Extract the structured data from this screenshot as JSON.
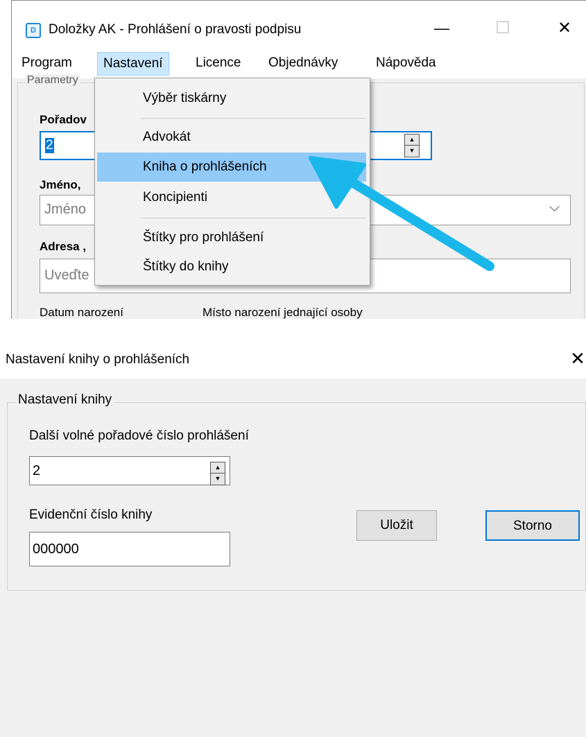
{
  "window": {
    "icon_letter": "D",
    "title": "Doložky AK - Prohlášení o pravosti podpisu",
    "min_glyph": "—",
    "max_glyph": "☐",
    "close_glyph": "✕"
  },
  "menubar": {
    "items": [
      "Program",
      "Nastavení",
      "Licence",
      "Objednávky",
      "Nápověda"
    ],
    "active": "Nastavení"
  },
  "params": {
    "legend": "Parametry",
    "poradove_label": "Pořadov",
    "poradove_value": "2",
    "jmeno_label": "Jméno, ",
    "jmeno_placeholder": "Jméno",
    "adresa_label": "Adresa ,",
    "adresa_placeholder": "Uveďte",
    "datum_label": "Datum narození",
    "misto_label": "Místo narození jednající osoby"
  },
  "dropdown": {
    "items": [
      "Výběr tiskárny",
      "Advokát",
      "Kniha o prohlášeních",
      "Koncipienti",
      "Štítky pro prohlášení",
      "Štítky do knihy"
    ],
    "highlighted": "Kniha o prohlášeních"
  },
  "annotation": {
    "arrow_color": "#1ab7ea"
  },
  "dialog": {
    "title": "Nastavení knihy o prohlášeních",
    "close_glyph": "✕",
    "group_legend": "Nastavení knihy",
    "dalsi_label": "Další volné pořadové číslo prohlášení",
    "dalsi_value": "2",
    "evid_label": "Evidenční číslo knihy",
    "evid_value": "000000",
    "save_label": "Uložit",
    "cancel_label": "Storno"
  },
  "colors": {
    "accent": "#0078d7",
    "menu_highlight": "#91c9f7",
    "menubar_active": "#cce8ff"
  }
}
